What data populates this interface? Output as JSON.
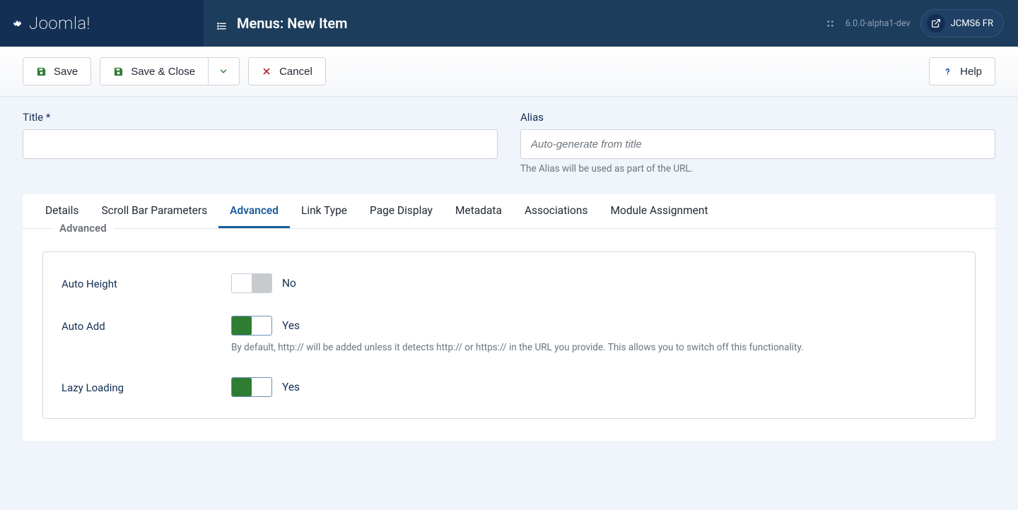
{
  "brand": "Joomla!",
  "header": {
    "page_title": "Menus: New Item",
    "version": "6.0.0-alpha1-dev",
    "site_label": "JCMS6 FR"
  },
  "toolbar": {
    "save": "Save",
    "save_close": "Save & Close",
    "cancel": "Cancel",
    "help": "Help"
  },
  "fields": {
    "title_label": "Title *",
    "title_value": "",
    "alias_label": "Alias",
    "alias_placeholder": "Auto-generate from title",
    "alias_hint": "The Alias will be used as part of the URL."
  },
  "tabs": [
    {
      "label": "Details",
      "active": false
    },
    {
      "label": "Scroll Bar Parameters",
      "active": false
    },
    {
      "label": "Advanced",
      "active": true
    },
    {
      "label": "Link Type",
      "active": false
    },
    {
      "label": "Page Display",
      "active": false
    },
    {
      "label": "Metadata",
      "active": false
    },
    {
      "label": "Associations",
      "active": false
    },
    {
      "label": "Module Assignment",
      "active": false
    }
  ],
  "advanced": {
    "legend": "Advanced",
    "auto_height": {
      "label": "Auto Height",
      "value_text": "No",
      "state": "off"
    },
    "auto_add": {
      "label": "Auto Add",
      "value_text": "Yes",
      "state": "on",
      "desc": "By default, http:// will be added unless it detects http:// or https:// in the URL you provide. This allows you to switch off this functionality."
    },
    "lazy_loading": {
      "label": "Lazy Loading",
      "value_text": "Yes",
      "state": "on"
    }
  }
}
